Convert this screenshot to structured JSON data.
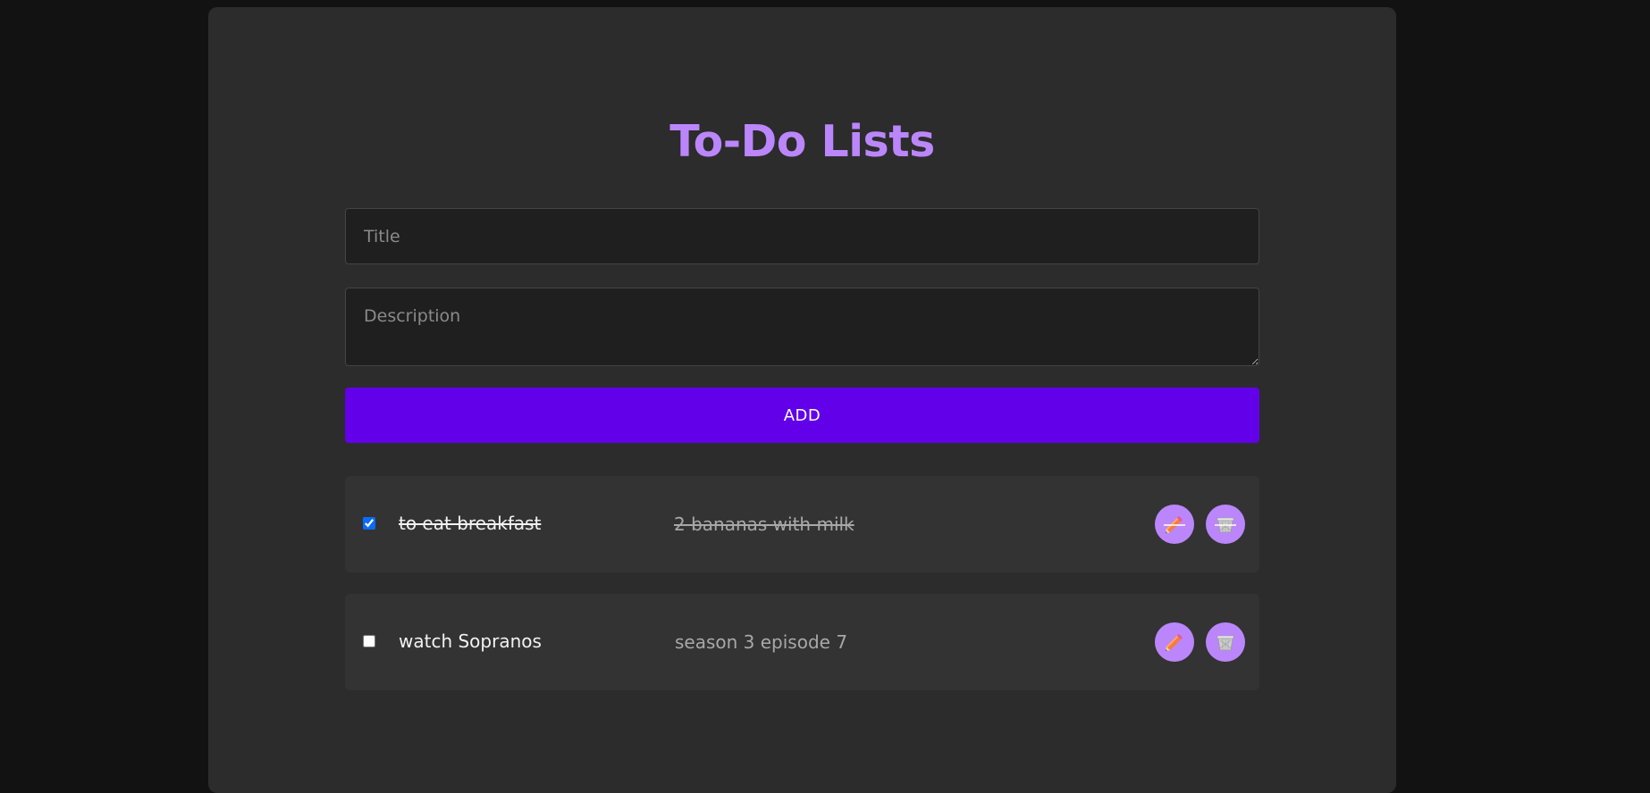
{
  "app": {
    "heading": "To-Do Lists"
  },
  "form": {
    "title_placeholder": "Title",
    "title_value": "",
    "description_placeholder": "Description",
    "description_value": "",
    "add_label": "ADD"
  },
  "todos": [
    {
      "title": "to eat breakfast",
      "description": "2 bananas with milk",
      "completed": true,
      "edit_icon": "pencil-icon",
      "delete_icon": "wastebasket-icon"
    },
    {
      "title": "watch Sopranos",
      "description": "season 3 episode 7",
      "completed": false,
      "edit_icon": "pencil-icon",
      "delete_icon": "wastebasket-icon"
    }
  ],
  "colors": {
    "accent": "#bb86fc",
    "primary": "#6200ea",
    "background": "#121212",
    "surface": "#2c2c2c"
  }
}
